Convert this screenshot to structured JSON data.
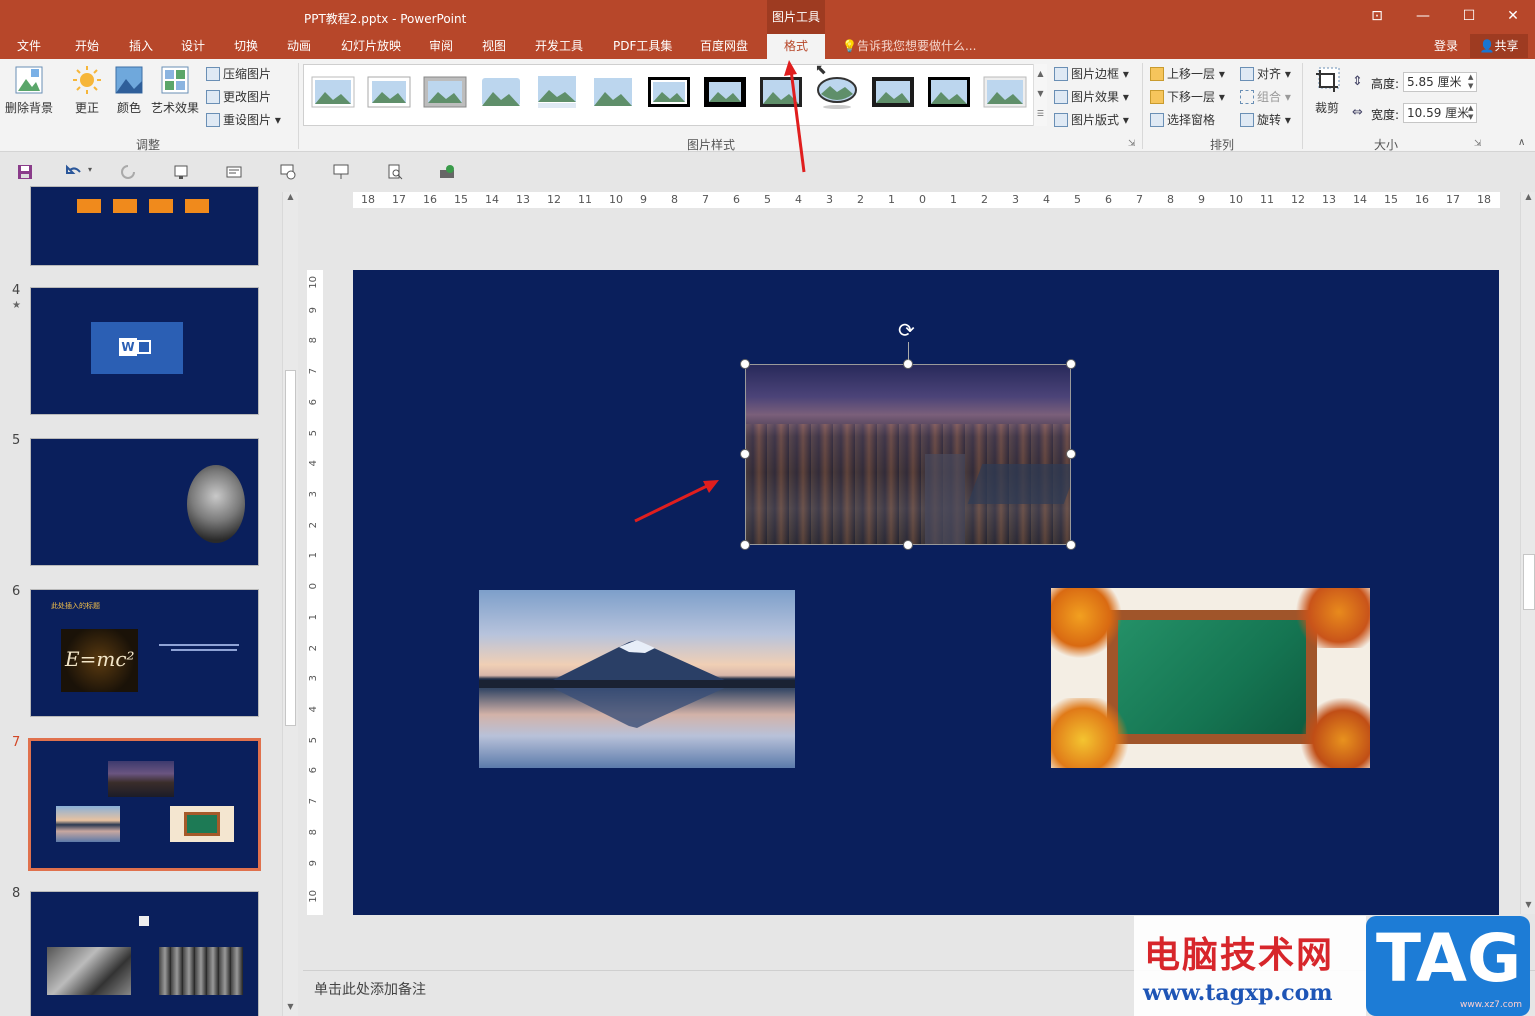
{
  "window": {
    "title": "PPT教程2.pptx - PowerPoint",
    "context_group": "图片工具",
    "buttons": {
      "restore_ribbon": "⊡",
      "minimize": "—",
      "maximize": "☐",
      "close": "✕"
    }
  },
  "tabs": [
    "文件",
    "开始",
    "插入",
    "设计",
    "切换",
    "动画",
    "幻灯片放映",
    "审阅",
    "视图",
    "开发工具",
    "PDF工具集",
    "百度网盘",
    "格式"
  ],
  "active_tab": "格式",
  "tell_me": "告诉我您想要做什么...",
  "account": {
    "signin": "登录",
    "share": "共享"
  },
  "ribbon": {
    "adjust": {
      "label": "调整",
      "remove_bg": "删除背景",
      "corrections": "更正",
      "color": "颜色",
      "artistic": "艺术效果",
      "compress": "压缩图片",
      "change": "更改图片",
      "reset": "重设图片"
    },
    "styles": {
      "label": "图片样式",
      "border": "图片边框",
      "effects": "图片效果",
      "layout": "图片版式"
    },
    "arrange": {
      "label": "排列",
      "bring_forward": "上移一层",
      "send_backward": "下移一层",
      "selection_pane": "选择窗格",
      "align": "对齐",
      "group": "组合",
      "rotate": "旋转"
    },
    "size": {
      "label": "大小",
      "crop": "裁剪",
      "height_label": "高度:",
      "height_value": "5.85 厘米",
      "width_label": "宽度:",
      "width_value": "10.59 厘米"
    }
  },
  "ruler": {
    "h_ticks": [
      "18",
      "17",
      "16",
      "15",
      "14",
      "13",
      "12",
      "11",
      "10",
      "9",
      "8",
      "7",
      "6",
      "5",
      "4",
      "3",
      "2",
      "1",
      "0",
      "1",
      "2",
      "3",
      "4",
      "5",
      "6",
      "7",
      "8",
      "9",
      "10",
      "11",
      "12",
      "13",
      "14",
      "15",
      "16",
      "17",
      "18"
    ],
    "v_ticks": [
      "10",
      "9",
      "8",
      "7",
      "6",
      "5",
      "4",
      "3",
      "2",
      "1",
      "0",
      "1",
      "2",
      "3",
      "4",
      "5",
      "6",
      "7",
      "8",
      "9",
      "10"
    ]
  },
  "slides": [
    {
      "num": "",
      "star": false
    },
    {
      "num": "4",
      "star": true
    },
    {
      "num": "5",
      "star": false
    },
    {
      "num": "6",
      "star": false,
      "title": "此处插入的标题",
      "formula": "E=mc²"
    },
    {
      "num": "7",
      "star": false,
      "selected": true
    },
    {
      "num": "8",
      "star": false
    }
  ],
  "notes_placeholder": "单击此处添加备注",
  "watermark": {
    "cn": "电脑技术网",
    "url": "www.tagxp.com",
    "tag": "TAG",
    "sub": "www.xz7.com"
  },
  "colors": {
    "accent": "#b7472a",
    "slide_bg": "#0a1f5c",
    "selection": "#e0714d"
  }
}
